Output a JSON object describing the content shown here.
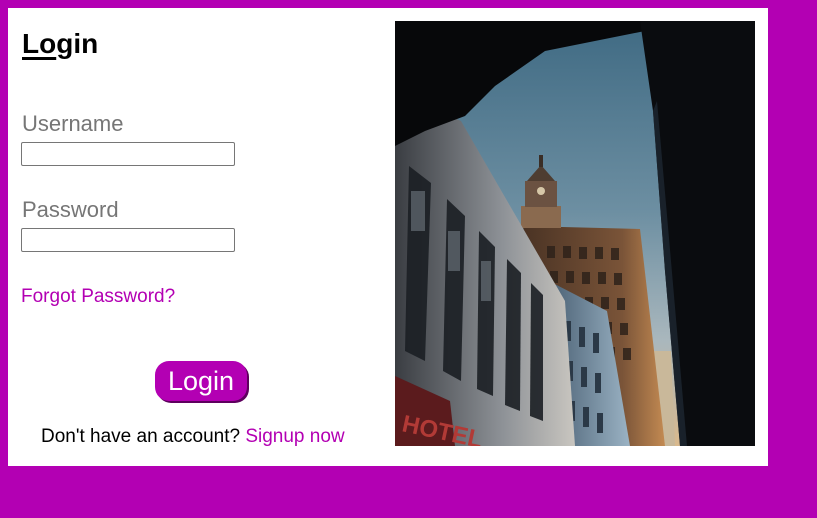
{
  "login": {
    "title": "Login",
    "username_label": "Username",
    "username_value": "",
    "password_label": "Password",
    "password_value": "",
    "forgot_link": "Forgot Password?",
    "login_button": "Login",
    "signup_prompt": "Don't have an account?",
    "signup_link": "Signup now"
  },
  "photo": {
    "subject": "city-buildings-photo"
  },
  "colors": {
    "accent": "#b300b3",
    "card": "#ffffff",
    "label": "#767676"
  }
}
